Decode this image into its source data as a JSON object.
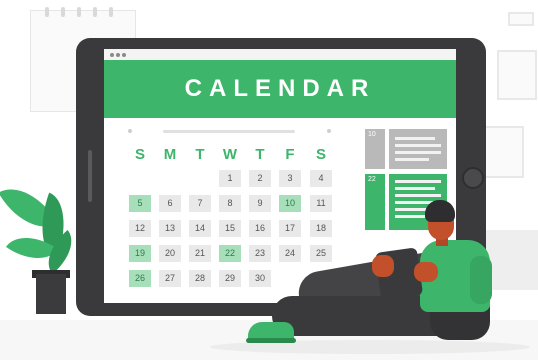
{
  "calendar": {
    "title": "CALENDAR",
    "weekdays": [
      "S",
      "M",
      "T",
      "W",
      "T",
      "F",
      "S"
    ],
    "days": [
      {
        "label": "1",
        "col": 3,
        "row": 0,
        "highlight": false
      },
      {
        "label": "2",
        "col": 4,
        "row": 0,
        "highlight": false
      },
      {
        "label": "3",
        "col": 5,
        "row": 0,
        "highlight": false
      },
      {
        "label": "4",
        "col": 6,
        "row": 0,
        "highlight": false
      },
      {
        "label": "5",
        "col": 0,
        "row": 1,
        "highlight": true
      },
      {
        "label": "6",
        "col": 1,
        "row": 1,
        "highlight": false
      },
      {
        "label": "7",
        "col": 2,
        "row": 1,
        "highlight": false
      },
      {
        "label": "8",
        "col": 3,
        "row": 1,
        "highlight": false
      },
      {
        "label": "9",
        "col": 4,
        "row": 1,
        "highlight": false
      },
      {
        "label": "10",
        "col": 5,
        "row": 1,
        "highlight": true
      },
      {
        "label": "11",
        "col": 6,
        "row": 1,
        "highlight": false
      },
      {
        "label": "12",
        "col": 0,
        "row": 2,
        "highlight": false
      },
      {
        "label": "13",
        "col": 1,
        "row": 2,
        "highlight": false
      },
      {
        "label": "14",
        "col": 2,
        "row": 2,
        "highlight": false
      },
      {
        "label": "15",
        "col": 3,
        "row": 2,
        "highlight": false
      },
      {
        "label": "16",
        "col": 4,
        "row": 2,
        "highlight": false
      },
      {
        "label": "17",
        "col": 5,
        "row": 2,
        "highlight": false
      },
      {
        "label": "18",
        "col": 6,
        "row": 2,
        "highlight": false
      },
      {
        "label": "19",
        "col": 0,
        "row": 3,
        "highlight": true
      },
      {
        "label": "20",
        "col": 1,
        "row": 3,
        "highlight": false
      },
      {
        "label": "21",
        "col": 2,
        "row": 3,
        "highlight": false
      },
      {
        "label": "22",
        "col": 3,
        "row": 3,
        "highlight": true
      },
      {
        "label": "23",
        "col": 4,
        "row": 3,
        "highlight": false
      },
      {
        "label": "24",
        "col": 5,
        "row": 3,
        "highlight": false
      },
      {
        "label": "25",
        "col": 6,
        "row": 3,
        "highlight": false
      },
      {
        "label": "26",
        "col": 0,
        "row": 4,
        "highlight": true
      },
      {
        "label": "27",
        "col": 1,
        "row": 4,
        "highlight": false
      },
      {
        "label": "28",
        "col": 2,
        "row": 4,
        "highlight": false
      },
      {
        "label": "29",
        "col": 3,
        "row": 4,
        "highlight": false
      },
      {
        "label": "30",
        "col": 4,
        "row": 4,
        "highlight": false
      }
    ]
  },
  "events": {
    "first_date": "10",
    "second_date": "22"
  },
  "colors": {
    "accent": "#3db56a",
    "highlight": "#a8dfbb",
    "device": "#3a3a3c",
    "skin": "#c1502b"
  }
}
